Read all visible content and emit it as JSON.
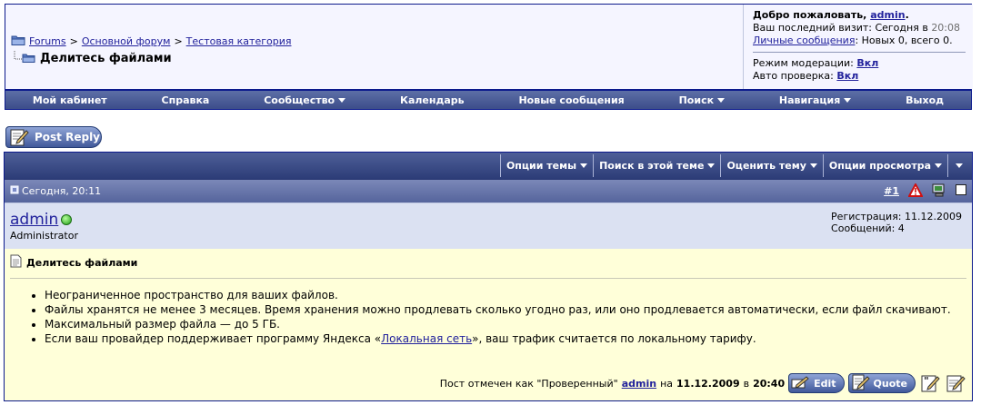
{
  "breadcrumb": {
    "items": [
      "Forums",
      "Основной форум",
      "Тестовая категория"
    ],
    "separator": ">",
    "current": "Делитесь файлами"
  },
  "welcome": {
    "greeting": "Добро пожаловать,",
    "user": "admin",
    "last_visit_label": "Ваш последний визит: Сегодня в",
    "last_visit_time": "20:08",
    "pm_link": "Личные сообщения",
    "pm_text": ": Новых 0, всего 0.",
    "moderation_label": "Режим модерации:",
    "moderation_value": "Вкл",
    "autocheck_label": "Авто проверка:",
    "autocheck_value": "Вкл"
  },
  "navbar": {
    "items": [
      {
        "label": "Мой кабинет",
        "menu": false
      },
      {
        "label": "Справка",
        "menu": false
      },
      {
        "label": "Сообщество",
        "menu": true
      },
      {
        "label": "Календарь",
        "menu": false
      },
      {
        "label": "Новые сообщения",
        "menu": false
      },
      {
        "label": "Поиск",
        "menu": true
      },
      {
        "label": "Навигация",
        "menu": true
      },
      {
        "label": "Выход",
        "menu": false
      }
    ]
  },
  "post_reply_label": "Post Reply",
  "thread_options": [
    "Опции темы",
    "Поиск в этой теме",
    "Оценить тему",
    "Опции просмотра"
  ],
  "post": {
    "date": "Сегодня, 20:11",
    "number": "#1",
    "username": "admin",
    "user_title": "Administrator",
    "registration": "Регистрация: 11.12.2009",
    "messages": "Сообщений: 4",
    "title": "Делитесь файлами",
    "bullets": [
      {
        "text": "Неограниченное пространство для ваших файлов."
      },
      {
        "text": "Файлы хранятся не менее 3 месяцев. Время хранения можно продлевать сколько угодно раз, или оно продлевается автоматически, если файл скачивают."
      },
      {
        "text": "Максимальный размер файла — до 5 ГБ."
      },
      {
        "pre": "Если ваш провайдер поддерживает программу Яндекса «",
        "link": "Локальная сеть",
        "post": "», ваш трафик считается по локальному тарифу."
      }
    ],
    "verified_text": "Пост отмечен как \"Проверенный\"",
    "verified_by": "admin",
    "verified_on": "на",
    "verified_date": "11.12.2009",
    "verified_at": "в",
    "verified_time": "20:40",
    "edit_label": "Edit",
    "quote_label": "Quote"
  },
  "colors": {
    "navbar": "#3c4d8a",
    "link": "#22229c",
    "post_body": "#ffffd9",
    "user_row": "#dbe1f2"
  }
}
